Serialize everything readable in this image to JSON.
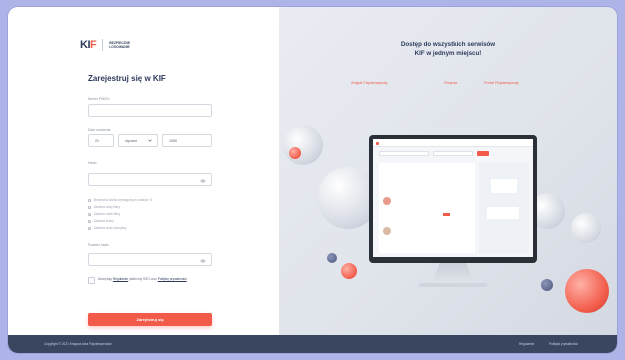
{
  "brand": {
    "logo_text": "KIF",
    "tagline_line1": "BEZPIECZNE",
    "tagline_line2": "LOGOWANIE"
  },
  "form": {
    "title": "Zarejestruj się w KIF",
    "pwz_label": "Numer PWZFz",
    "birth_label": "Data urodzenia",
    "day": "21",
    "month": "styczeń",
    "year": "1900",
    "password_label": "Hasło",
    "requirements": [
      "Minimalna liczba wymaganych znaków: 8",
      "Zawiera duży litery",
      "Zawiera małe litery",
      "Zawiera liczby",
      "Zawiera znak specjalny"
    ],
    "repeat_label": "Powtórz hasło",
    "consent_prefix": "Akceptuję",
    "consent_regulamin": "Regulamin",
    "consent_middle": "platformy SSO oraz",
    "consent_policy": "Politykę prywatności",
    "submit": "Zarejestruj się"
  },
  "hero": {
    "line1": "Dostęp do wszystkich serwisów",
    "line2": "KIF w jednym miejscu!",
    "links": [
      "Znajdź Fizjoterapeutę",
      "Finanse",
      "Portal Fizjoterapeuty"
    ]
  },
  "footer": {
    "copyright": "Copyright © 2021 Krajowa Izba Fizjoterapeutów",
    "regulamin": "Regulamin",
    "privacy": "Polityka prywatności"
  },
  "colors": {
    "accent": "#f25b4a",
    "navy": "#2d3a5c",
    "footer": "#3a4660",
    "page_bg": "#aeb3e8"
  },
  "icons": {
    "password_toggle": "eye-icon",
    "month_dropdown": "chevron-down-icon"
  }
}
